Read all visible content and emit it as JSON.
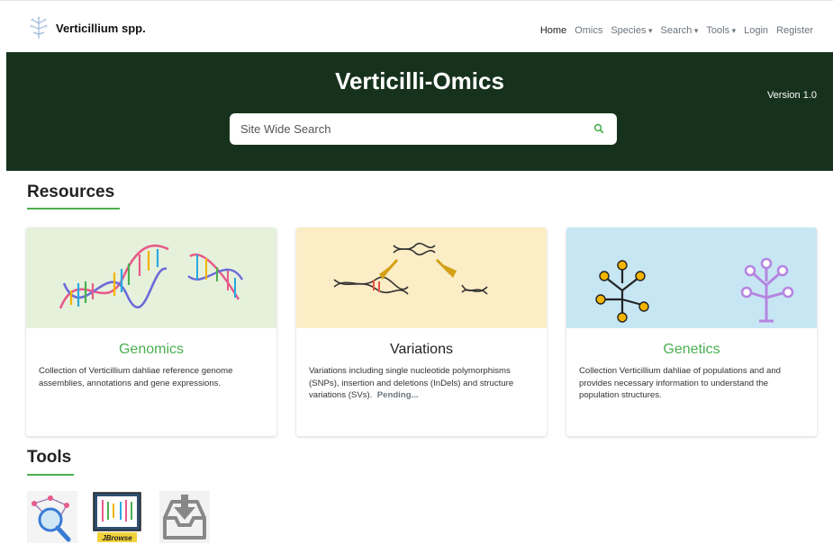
{
  "brand": {
    "name": "Verticillium spp."
  },
  "nav": {
    "items": [
      {
        "label": "Home",
        "active": true,
        "dropdown": false
      },
      {
        "label": "Omics",
        "active": false,
        "dropdown": false
      },
      {
        "label": "Species",
        "active": false,
        "dropdown": true
      },
      {
        "label": "Search",
        "active": false,
        "dropdown": true
      },
      {
        "label": "Tools",
        "active": false,
        "dropdown": true
      },
      {
        "label": "Login",
        "active": false,
        "dropdown": false
      },
      {
        "label": "Register",
        "active": false,
        "dropdown": false
      }
    ]
  },
  "hero": {
    "title": "Verticilli-Omics",
    "version": "Version 1.0",
    "search_placeholder": "Site Wide Search",
    "background": "#17321c"
  },
  "resources": {
    "heading": "Resources",
    "cards": [
      {
        "title": "Genomics",
        "description": "Collection of Verticillium dahliae reference genome assemblies, annotations and gene expressions.",
        "image_icon": "dna-helix-icon",
        "title_color": "#4caf50"
      },
      {
        "title": "Variations",
        "description": "Variations including single nucleotide polymorphisms (SNPs), insertion and deletions (InDels) and structure variations (SVs).",
        "status": "Pending...",
        "image_icon": "dna-variation-icon",
        "title_color": "#222222"
      },
      {
        "title": "Genetics",
        "description": "Collection Verticillium dahliae of populations and and provides necessary information to understand the population structures.",
        "image_icon": "population-tree-icon",
        "title_color": "#4caf50"
      }
    ]
  },
  "tools": {
    "heading": "Tools",
    "items": [
      {
        "icon": "network-search-icon"
      },
      {
        "icon": "jbrowse-icon",
        "caption": "JBrowse"
      },
      {
        "icon": "download-tray-icon"
      }
    ]
  },
  "colors": {
    "accent": "#4caf50",
    "hero_bg": "#17321c"
  }
}
